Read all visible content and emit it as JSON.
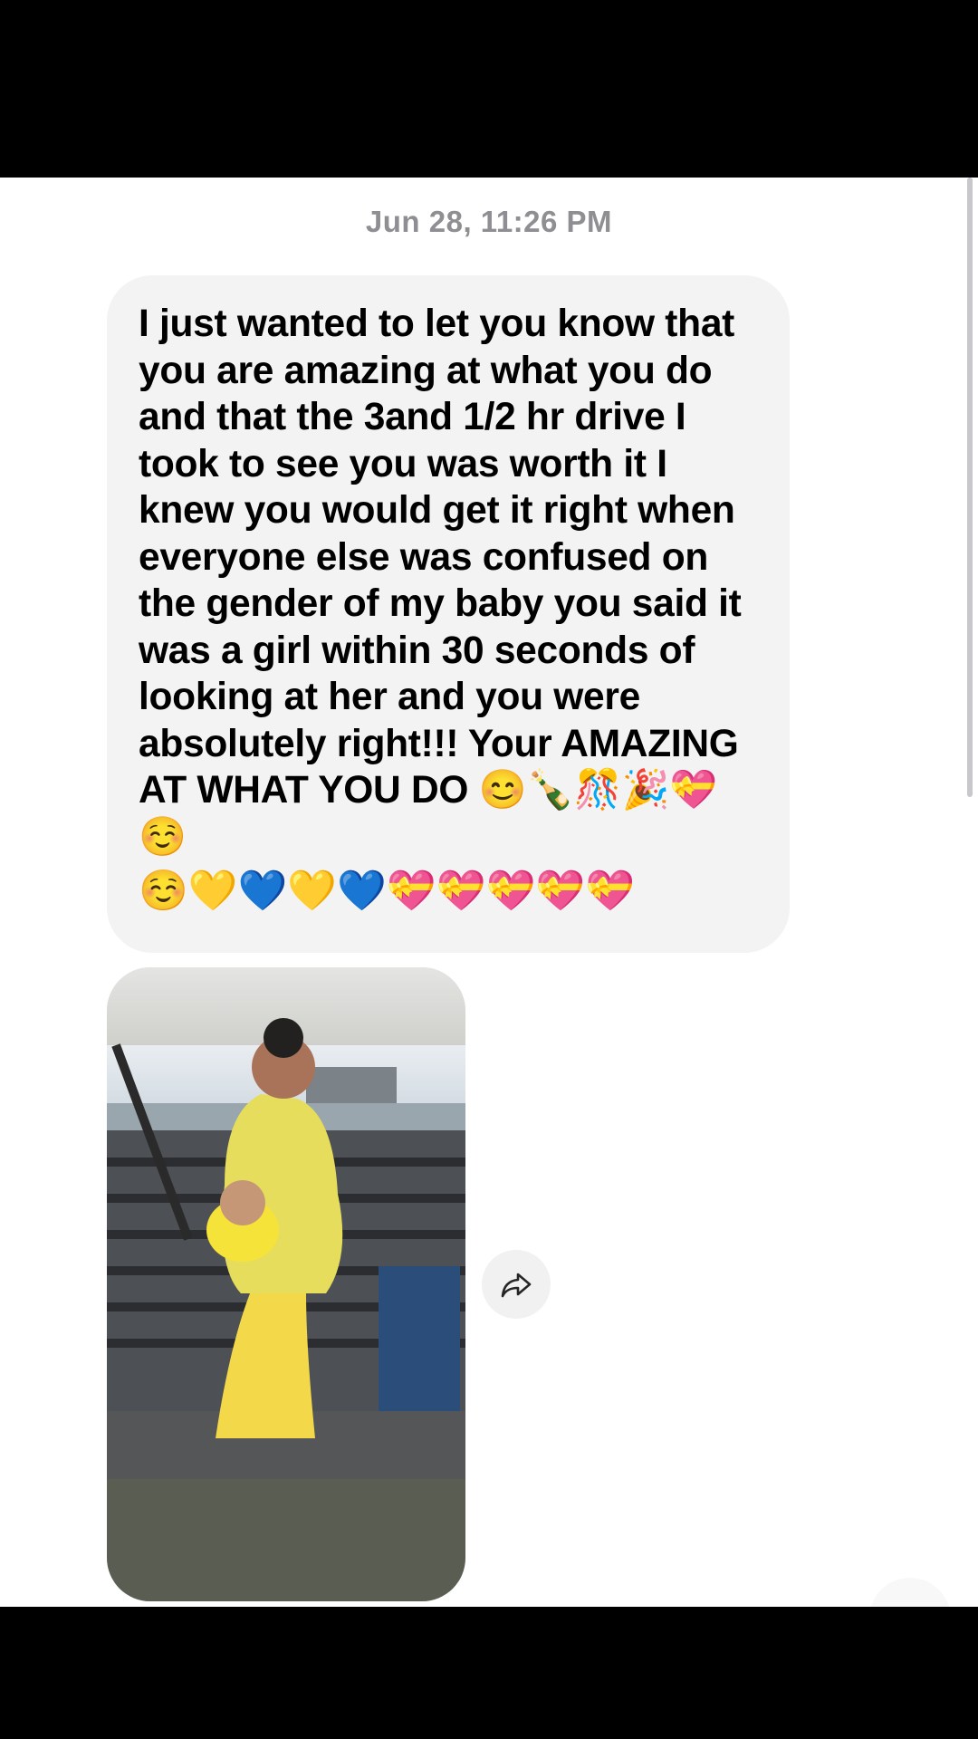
{
  "conversation": {
    "timestamp": "Jun 28, 11:26 PM",
    "message": {
      "text": "I just wanted to let you know that you are amazing at what you do and that the 3and 1/2 hr drive I took to see you was worth it I knew you would get it right when everyone else was confused on the gender of my baby you said it was a girl within 30 seconds of looking at her and you were absolutely right!!! Your AMAZING AT WHAT YOU DO 😊🍾🎊🎉💝☺️",
      "emoji_line": "☺️💛💙💛💙💝💝💝💝💝"
    },
    "photo_icon": "photo-attachment",
    "share_icon": "share-arrow-icon"
  }
}
